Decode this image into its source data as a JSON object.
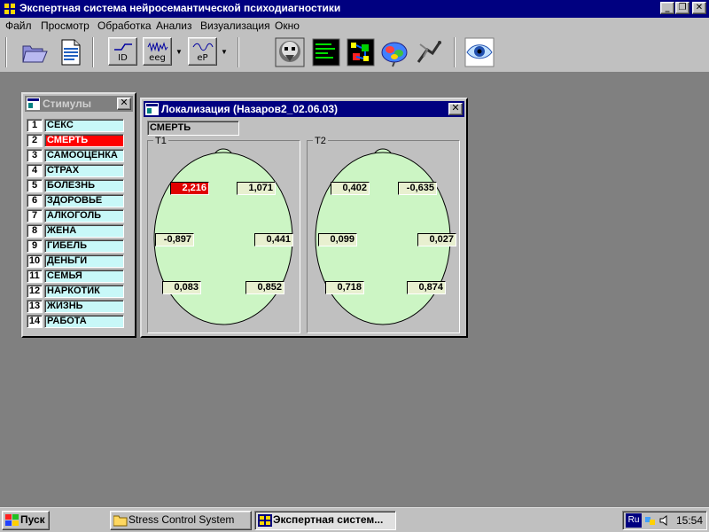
{
  "app": {
    "title": "Экспертная система нейросемантической психодиагностики",
    "menu": [
      "Файл",
      "Просмотр",
      "Обработка",
      "Анализ",
      "Визуализация",
      "Окно"
    ]
  },
  "toolbar": {
    "id_label": "ID",
    "eeg_label": "eeg",
    "ep_label": "eP"
  },
  "stimuli": {
    "title": "Стимулы",
    "items": [
      {
        "n": "1",
        "label": "СЕКС"
      },
      {
        "n": "2",
        "label": "СМЕРТЬ",
        "selected": true
      },
      {
        "n": "3",
        "label": "САМООЦЕНКА"
      },
      {
        "n": "4",
        "label": "СТРАХ"
      },
      {
        "n": "5",
        "label": "БОЛЕЗНЬ"
      },
      {
        "n": "6",
        "label": "ЗДОРОВЬЕ"
      },
      {
        "n": "7",
        "label": "АЛКОГОЛЬ"
      },
      {
        "n": "8",
        "label": "ЖЕНА"
      },
      {
        "n": "9",
        "label": "ГИБЕЛЬ"
      },
      {
        "n": "10",
        "label": "ДЕНЬГИ"
      },
      {
        "n": "11",
        "label": "СЕМЬЯ"
      },
      {
        "n": "12",
        "label": "НАРКОТИК"
      },
      {
        "n": "13",
        "label": "ЖИЗНЬ"
      },
      {
        "n": "14",
        "label": "РАБОТА"
      }
    ]
  },
  "localization": {
    "title": "Локализация (Назаров2_02.06.03)",
    "stimulus": "СМЕРТЬ",
    "t1": {
      "label": "T1",
      "values": [
        "2,216",
        "1,071",
        "-0,897",
        "0,441",
        "0,083",
        "0,852"
      ]
    },
    "t2": {
      "label": "T2",
      "values": [
        "0,402",
        "-0,635",
        "0,099",
        "0,027",
        "0,718",
        "0,874"
      ]
    }
  },
  "taskbar": {
    "start": "Пуск",
    "tasks": [
      "Stress Control System",
      "Экспертная систем..."
    ],
    "lang": "Ru",
    "clock": "15:54"
  },
  "colors": {
    "titlebar": "#000080",
    "inactive_caption": "#808080",
    "head_fill": "#ccf5c4",
    "highlight": "#ff0000",
    "list_bg": "#c8f8f8"
  }
}
